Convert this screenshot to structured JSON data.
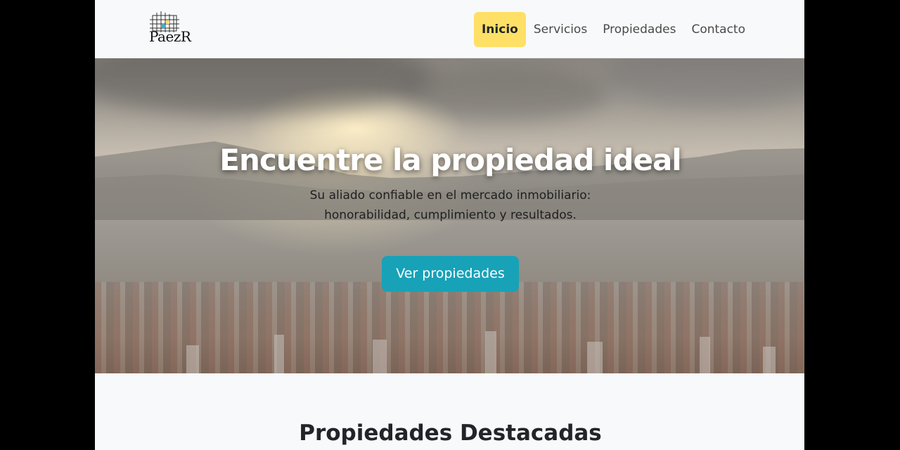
{
  "brand": {
    "logo_text": "PaezR",
    "logo_icon": "building-grid-icon"
  },
  "nav": {
    "items": [
      {
        "label": "Inicio",
        "active": true
      },
      {
        "label": "Servicios",
        "active": false
      },
      {
        "label": "Propiedades",
        "active": false
      },
      {
        "label": "Contacto",
        "active": false
      }
    ]
  },
  "hero": {
    "title": "Encuentre la propiedad ideal",
    "subtitle_line1": "Su aliado confiable en el mercado inmobiliario:",
    "subtitle_line2": "honorabilidad, cumplimiento y resultados.",
    "cta_label": "Ver propiedades",
    "cta_color": "#17a2b8"
  },
  "featured": {
    "title": "Propiedades Destacadas"
  },
  "colors": {
    "active_nav": "#ffe066",
    "page_bg": "#f8f9fa",
    "side_bg": "#000000"
  }
}
